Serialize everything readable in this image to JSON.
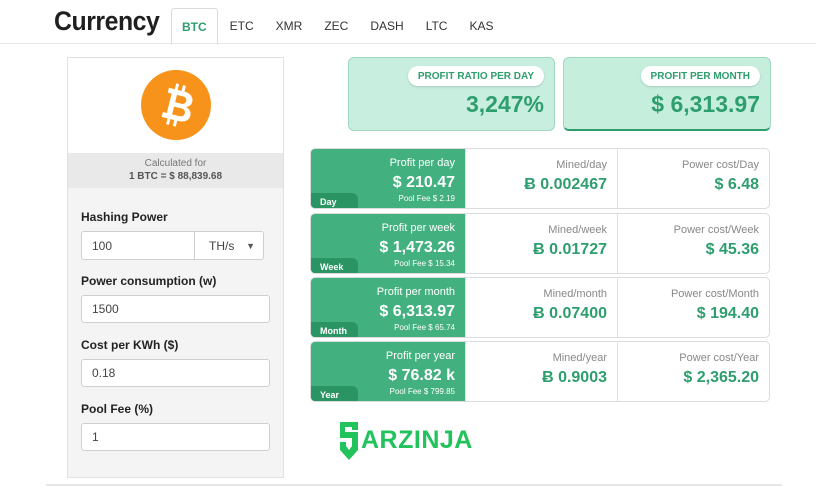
{
  "header": {
    "title": "Currency",
    "tabs": [
      {
        "label": "BTC",
        "active": true
      },
      {
        "label": "ETC"
      },
      {
        "label": "XMR"
      },
      {
        "label": "ZEC"
      },
      {
        "label": "DASH"
      },
      {
        "label": "LTC"
      },
      {
        "label": "KAS"
      }
    ]
  },
  "left": {
    "logo_icon": "bitcoin-logo",
    "calc_label": "Calculated for",
    "calc_value": "1 BTC = $ 88,839.68",
    "hashing_power": {
      "label": "Hashing Power",
      "value": "100",
      "unit": "TH/s"
    },
    "power_consumption": {
      "label": "Power consumption (w)",
      "value": "1500"
    },
    "cost_per_kwh": {
      "label": "Cost per KWh ($)",
      "value": "0.18"
    },
    "pool_fee": {
      "label": "Pool Fee (%)",
      "value": "1"
    }
  },
  "stats": {
    "profit_ratio": {
      "label": "PROFIT RATIO PER DAY",
      "value": "3,247%"
    },
    "profit_month": {
      "label": "PROFIT PER MONTH",
      "value": "$ 6,313.97"
    }
  },
  "rows": [
    {
      "period": "Day",
      "profit_label": "Profit per day",
      "profit_value": "$ 210.47",
      "fee": "Pool Fee $ 2.19",
      "mined_label": "Mined/day",
      "mined_value": "Ƀ 0.002467",
      "cost_label": "Power cost/Day",
      "cost_value": "$ 6.48"
    },
    {
      "period": "Week",
      "profit_label": "Profit per week",
      "profit_value": "$ 1,473.26",
      "fee": "Pool Fee $ 15.34",
      "mined_label": "Mined/week",
      "mined_value": "Ƀ 0.01727",
      "cost_label": "Power cost/Week",
      "cost_value": "$ 45.36"
    },
    {
      "period": "Month",
      "profit_label": "Profit per month",
      "profit_value": "$ 6,313.97",
      "fee": "Pool Fee $ 65.74",
      "mined_label": "Mined/month",
      "mined_value": "Ƀ 0.07400",
      "cost_label": "Power cost/Month",
      "cost_value": "$ 194.40"
    },
    {
      "period": "Year",
      "profit_label": "Profit per year",
      "profit_value": "$ 76.82 k",
      "fee": "Pool Fee $ 799.85",
      "mined_label": "Mined/year",
      "mined_value": "Ƀ 0.9003",
      "cost_label": "Power cost/Year",
      "cost_value": "$ 2,365.20"
    }
  ],
  "watermark": {
    "text": "ARZINJA",
    "icon": "arzinja-logo-icon"
  },
  "colors": {
    "accent": "#2e9e6e",
    "row_green": "#43b07f",
    "card_bg": "#c8eedf",
    "bitcoin_orange": "#f7931a",
    "watermark_green": "#22c25d"
  }
}
